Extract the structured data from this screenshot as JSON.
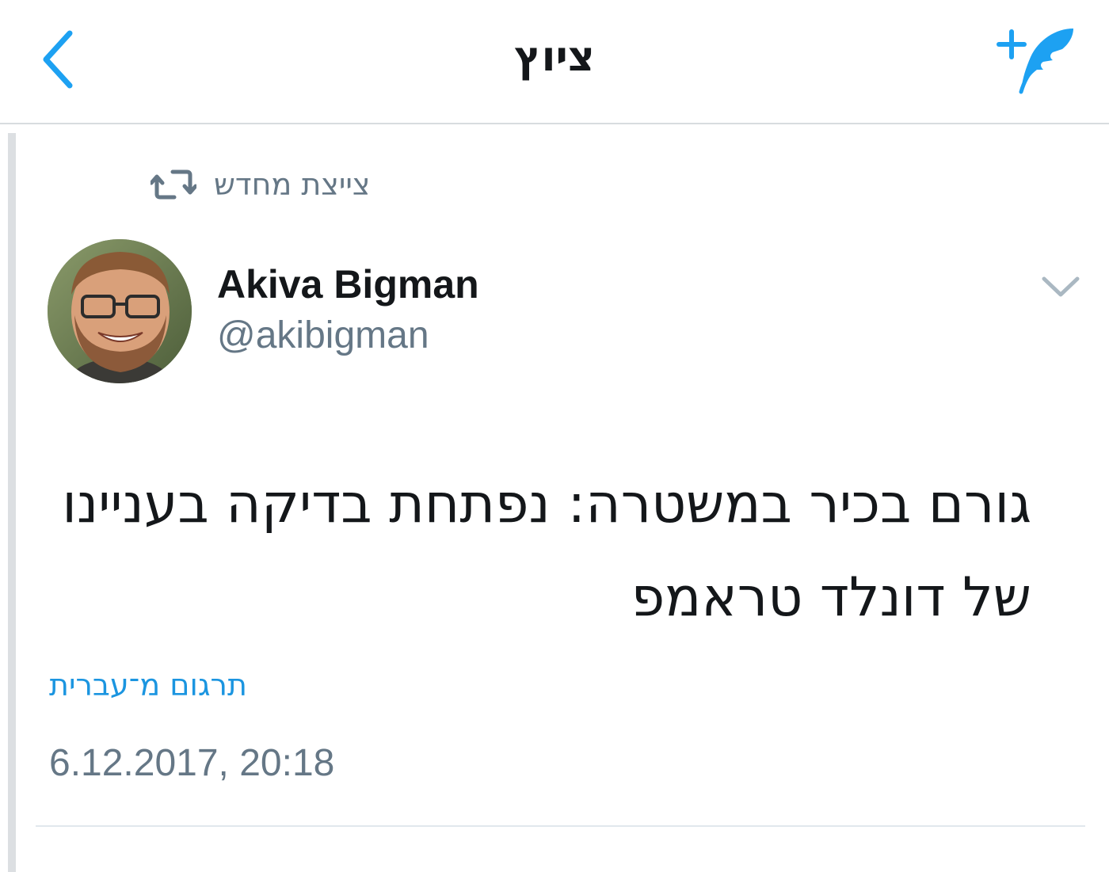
{
  "navbar": {
    "title": "ציוץ",
    "back_icon": "chevron-left-icon",
    "compose_icon": "compose-tweet-icon",
    "accent_color": "#1da1f2"
  },
  "retweet": {
    "label": "צייצת מחדש",
    "icon": "retweet-icon"
  },
  "author": {
    "name": "Akiva Bigman",
    "handle": "@akibigman"
  },
  "tweet": {
    "text": "גורם בכיר במשטרה: נפתחת בדיקה בעניינו של דונלד טראמפ",
    "translate_label": "תרגום מ־עברית",
    "timestamp": "6.12.2017, 20:18"
  },
  "colors": {
    "primary_text": "#14171a",
    "secondary_text": "#657786",
    "link": "#1b95e0"
  }
}
